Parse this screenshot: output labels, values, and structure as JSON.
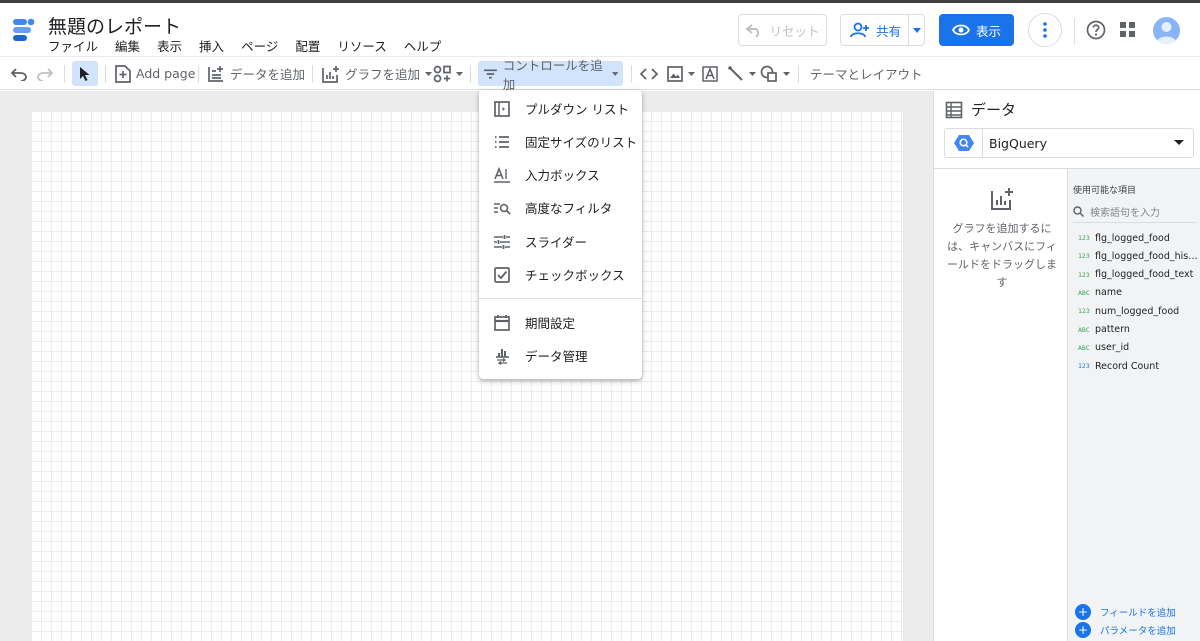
{
  "app": {
    "title": "無題のレポート",
    "menu": [
      "ファイル",
      "編集",
      "表示",
      "挿入",
      "ページ",
      "配置",
      "リソース",
      "ヘルプ"
    ]
  },
  "header": {
    "reset_label": "リセット",
    "share_label": "共有",
    "view_label": "表示"
  },
  "toolbar": {
    "add_page": "Add page",
    "add_data": "データを追加",
    "add_chart": "グラフを追加",
    "add_control": "コントロールを追加",
    "theme_layout": "テーマとレイアウト"
  },
  "control_menu": {
    "items": [
      {
        "label": "プルダウン リスト",
        "icon": "dropdown-list-icon"
      },
      {
        "label": "固定サイズのリスト",
        "icon": "fixed-list-icon"
      },
      {
        "label": "入力ボックス",
        "icon": "input-box-icon"
      },
      {
        "label": "高度なフィルタ",
        "icon": "advanced-filter-icon"
      },
      {
        "label": "スライダー",
        "icon": "slider-icon"
      },
      {
        "label": "チェックボックス",
        "icon": "checkbox-icon"
      }
    ],
    "items2": [
      {
        "label": "期間設定",
        "icon": "calendar-icon"
      },
      {
        "label": "データ管理",
        "icon": "data-control-icon"
      }
    ]
  },
  "panel": {
    "title": "データ",
    "datasource": "BigQuery",
    "hint": "グラフを追加するには、キャンバスにフィールドをドラッグします",
    "fields_title": "使用可能な項目",
    "search_placeholder": "検索語句を入力",
    "fields": [
      {
        "type": "123",
        "name": "flg_logged_food",
        "color": "#34a853"
      },
      {
        "type": "123",
        "name": "flg_logged_food_historical",
        "color": "#34a853"
      },
      {
        "type": "123",
        "name": "flg_logged_food_text",
        "color": "#34a853"
      },
      {
        "type": "ABC",
        "name": "name",
        "color": "#34a853"
      },
      {
        "type": "123",
        "name": "num_logged_food",
        "color": "#34a853"
      },
      {
        "type": "ABC",
        "name": "pattern",
        "color": "#34a853"
      },
      {
        "type": "ABC",
        "name": "user_id",
        "color": "#34a853"
      },
      {
        "type": "123",
        "name": "Record Count",
        "color": "#1a73e8"
      }
    ],
    "add_field": "フィールドを追加",
    "add_parameter": "パラメータを追加"
  },
  "colors": {
    "accent": "#1a73e8",
    "active_tool": "#d2e3fc"
  }
}
